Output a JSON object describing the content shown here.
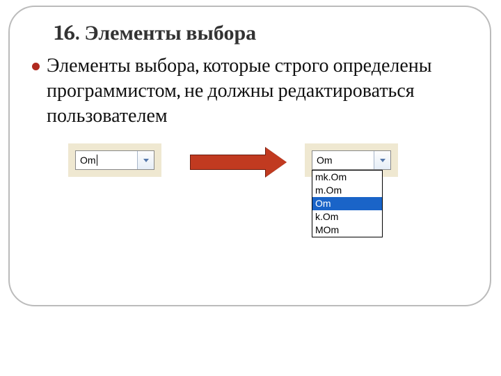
{
  "slide": {
    "title": "16. Элементы выбора",
    "bullet_text": "Элементы выбора, которые строго определены программистом, не должны редактироваться пользователем"
  },
  "combo": {
    "left_value": "Om",
    "right_value": "Om",
    "options": [
      "mk.Om",
      "m.Om",
      "Om",
      "k.Om",
      "MOm"
    ],
    "selected_index": 2
  }
}
